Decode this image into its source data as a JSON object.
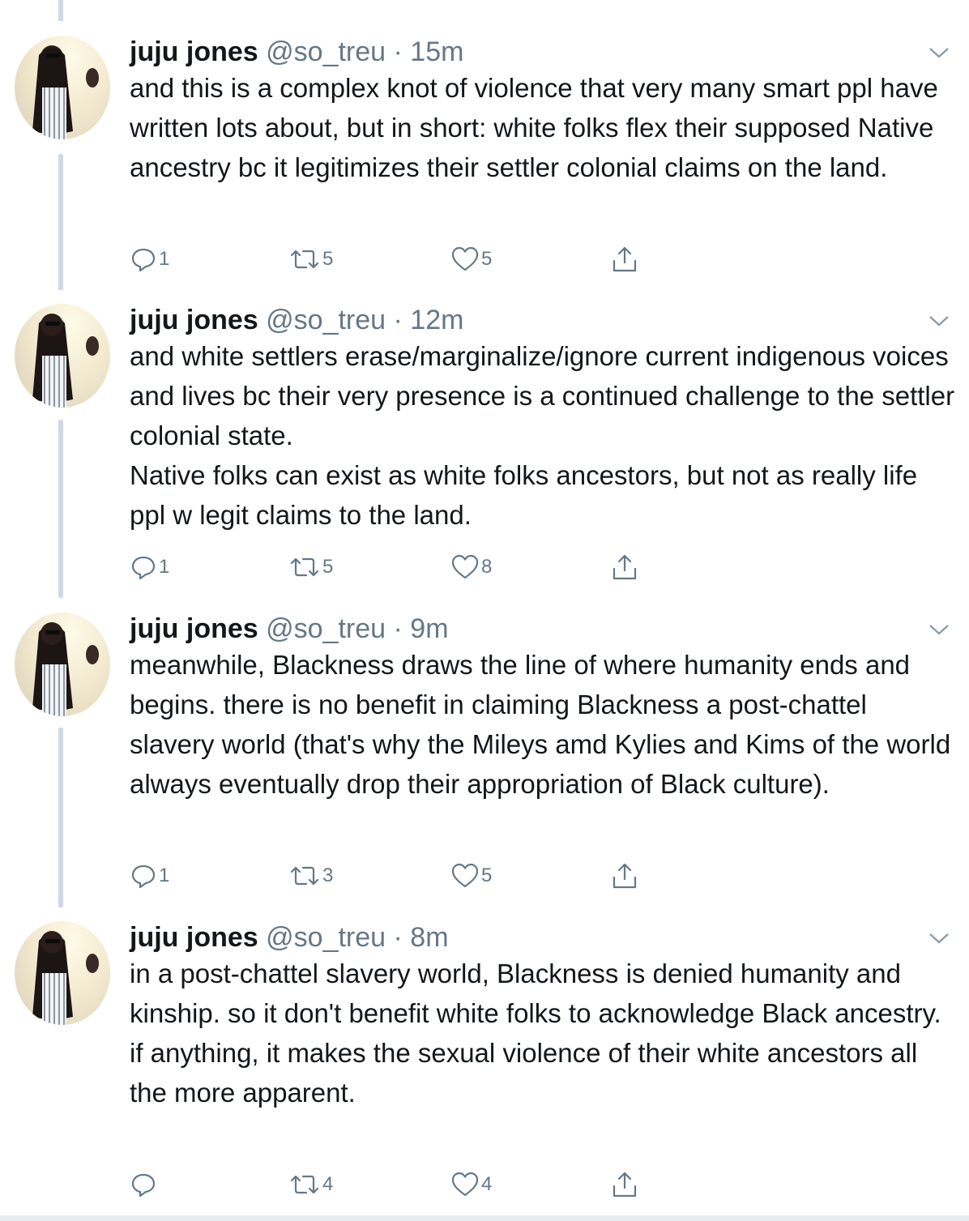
{
  "tweets": [
    {
      "display_name": "juju jones",
      "handle": "@so_treu",
      "separator": "·",
      "time": "15m",
      "text": "and this is a complex knot of violence that very many smart ppl have written lots about, but in short: white folks flex their supposed Native ancestry bc it legitimizes their settler colonial claims on the land.",
      "replies": "1",
      "retweets": "5",
      "likes": "5"
    },
    {
      "display_name": "juju jones",
      "handle": "@so_treu",
      "separator": "·",
      "time": "12m",
      "text": "and white settlers erase/marginalize/ignore current indigenous voices and lives bc their very presence is a continued challenge to the settler colonial state.\nNative folks can exist as white folks ancestors, but not as really life ppl w legit claims to the land.",
      "replies": "1",
      "retweets": "5",
      "likes": "8"
    },
    {
      "display_name": "juju jones",
      "handle": "@so_treu",
      "separator": "·",
      "time": "9m",
      "text": "meanwhile, Blackness draws the line of where humanity ends and begins. there is no benefit in claiming Blackness a post-chattel slavery world (that's why the Mileys amd Kylies and Kims of the world always eventually drop their appropriation of Black culture).",
      "replies": "1",
      "retweets": "3",
      "likes": "5"
    },
    {
      "display_name": "juju jones",
      "handle": "@so_treu",
      "separator": "·",
      "time": "8m",
      "text": "in a post-chattel slavery world, Blackness is denied humanity and kinship. so it don't benefit white folks to acknowledge Black ancestry. if anything, it makes the sexual violence of their white ancestors all the more apparent.",
      "replies": "",
      "retweets": "4",
      "likes": "4"
    }
  ],
  "icons": {
    "reply": "reply-icon",
    "retweet": "retweet-icon",
    "like": "heart-icon",
    "share": "share-icon",
    "menu": "chevron-down-icon"
  },
  "colors": {
    "text": "#14171a",
    "secondary": "#657786",
    "thread_line": "#cdd9e4"
  }
}
